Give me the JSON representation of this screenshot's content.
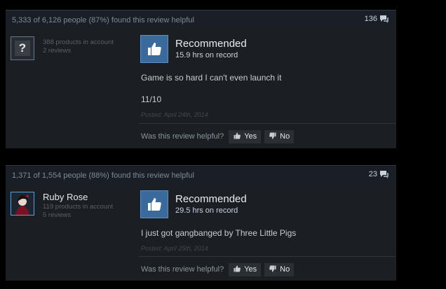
{
  "reviews": [
    {
      "helpful_text": "5,333 of 6,126 people (87%) found this review helpful",
      "comment_count": "136",
      "author_name": "",
      "products": "388 products in account",
      "reviews_count": "2 reviews",
      "recommendation": "Recommended",
      "hours": "15.9 hrs on record",
      "body_lines": [
        "Game is so hard I can't even launch it",
        "11/10"
      ],
      "posted": "Posted: April 24th, 2014",
      "helpful_question": "Was this review helpful?",
      "yes_label": "Yes",
      "no_label": "No",
      "avatar_text": "?"
    },
    {
      "helpful_text": "1,371 of 1,554 people (88%) found this review helpful",
      "comment_count": "23",
      "author_name": "Ruby Rose",
      "products": "119 products in account",
      "reviews_count": "5 reviews",
      "recommendation": "Recommended",
      "hours": "29.5 hrs on record",
      "body_lines": [
        "I just got gangbanged by Three Little Pigs"
      ],
      "posted": "Posted: April 25th, 2014",
      "helpful_question": "Was this review helpful?",
      "yes_label": "Yes",
      "no_label": "No"
    }
  ],
  "icons": {
    "comment": "comment-icon",
    "thumbs_up": "thumbs-up-icon",
    "thumbs_down": "thumbs-down-icon"
  },
  "colors": {
    "accent_blue": "#3a6a9c",
    "background": "#1b1e22"
  }
}
